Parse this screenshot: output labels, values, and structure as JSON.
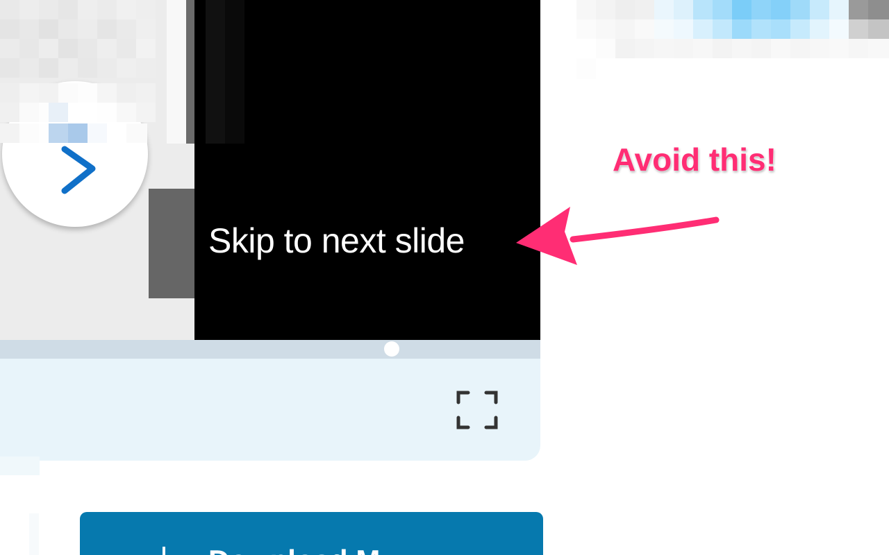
{
  "slide": {
    "next_button_label": "Next slide",
    "tooltip": "Skip to next slide"
  },
  "controls": {
    "fullscreen_label": "Fullscreen"
  },
  "download": {
    "label": "Download M"
  },
  "annotation": {
    "text": "Avoid this!",
    "color": "#ff2d74"
  },
  "colors": {
    "accent": "#0679ae",
    "chevron": "#1070c8",
    "controls_bg": "#e8f4fa",
    "progress_track": "#cfdce6"
  },
  "icons": {
    "next": "chevron-right-icon",
    "fullscreen": "fullscreen-icon",
    "download": "download-icon",
    "arrow": "arrow-left-icon"
  }
}
